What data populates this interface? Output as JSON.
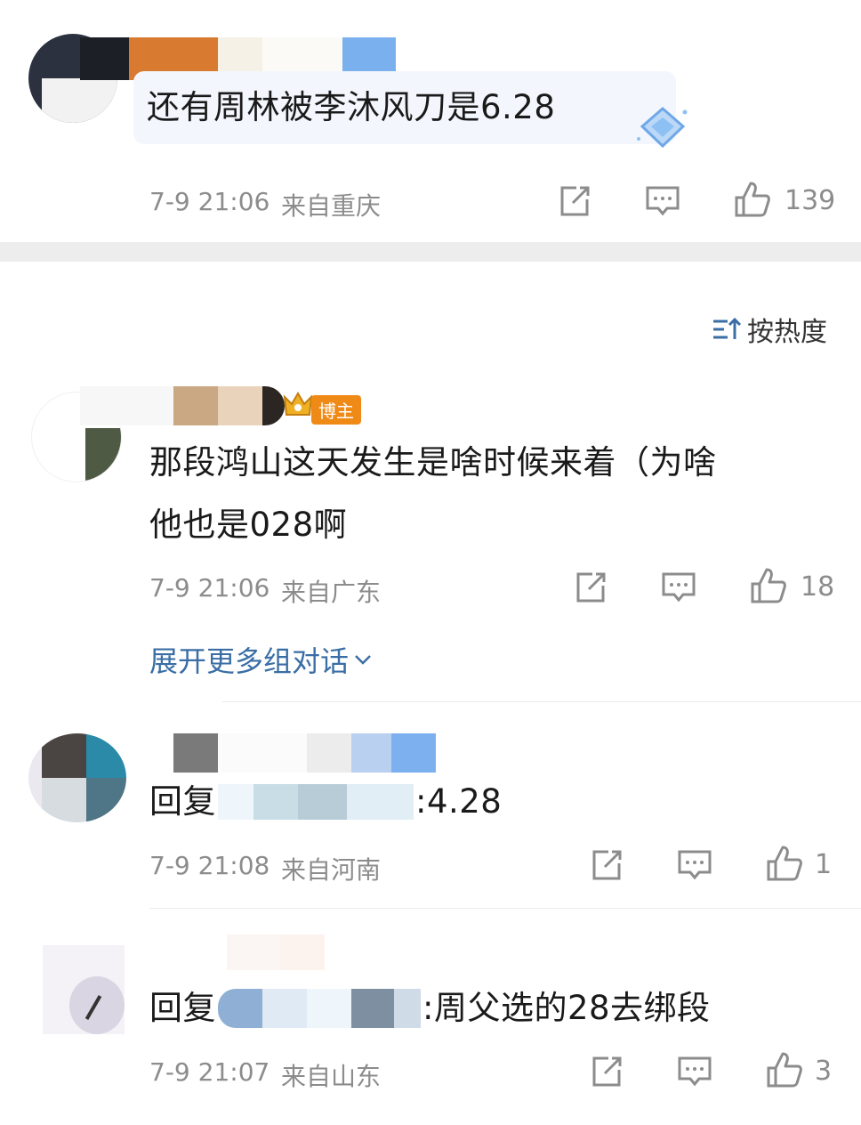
{
  "comments": [
    {
      "text": "还有周林被李沐风刀是6.28",
      "time": "7-9 21:06",
      "location": "来自重庆",
      "likes": "139"
    },
    {
      "text_line1": "那段鸿山这天发生是啥时候来着（为啥",
      "text_line2": "他也是028啊",
      "time": "7-9 21:06",
      "location": "来自广东",
      "likes": "18",
      "badge": "博主"
    },
    {
      "prefix": "回复",
      "suffix": ":4.28",
      "time": "7-9 21:08",
      "location": "来自河南",
      "likes": "1"
    },
    {
      "prefix": "回复",
      "suffix": ":周父选的28去绑段",
      "time": "7-9 21:07",
      "location": "来自山东",
      "likes": "3"
    }
  ],
  "sort_label": "按热度",
  "expand_label": "展开更多组对话",
  "colors": {
    "accent": "#3a6ea5",
    "meta": "#8c8c8c",
    "badge": "#f08a17"
  },
  "icons": [
    "share-icon",
    "comment-icon",
    "like-icon",
    "sort-icon",
    "chevron-down-icon",
    "crown-icon",
    "diamond-icon"
  ]
}
